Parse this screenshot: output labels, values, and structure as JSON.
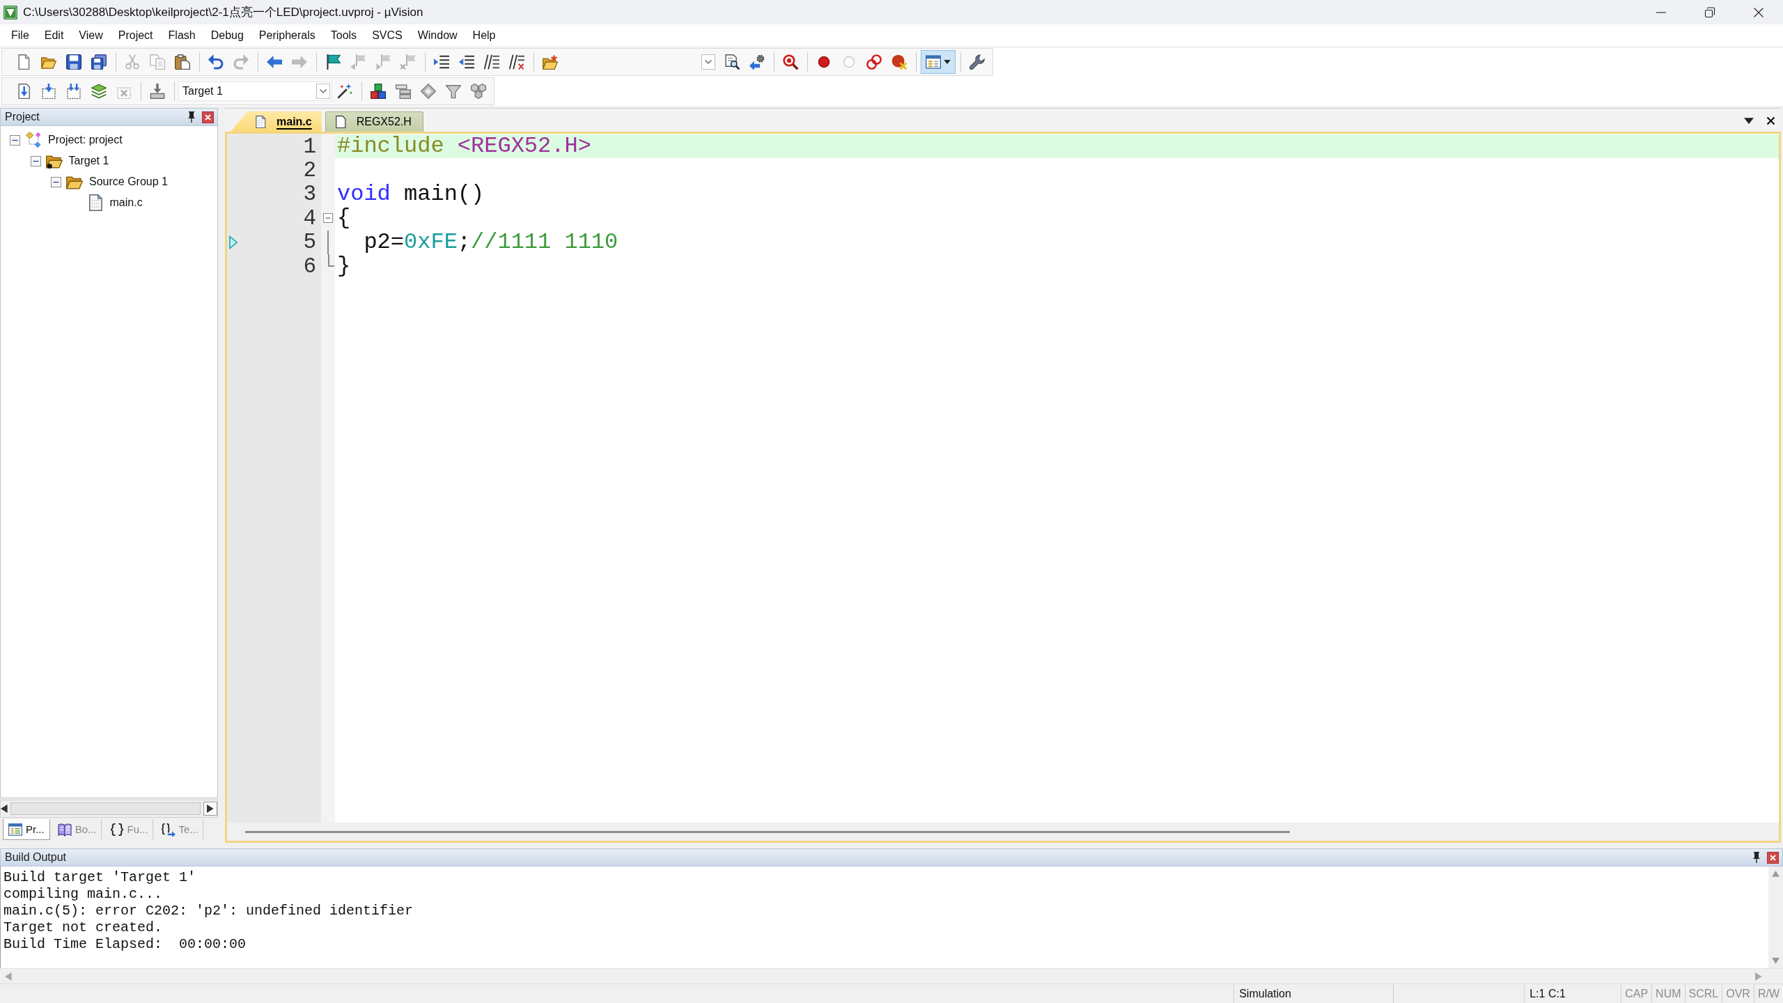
{
  "window": {
    "title": "C:\\Users\\30288\\Desktop\\keilproject\\2-1点亮一个LED\\project.uvproj - µVision"
  },
  "menu": [
    "File",
    "Edit",
    "View",
    "Project",
    "Flash",
    "Debug",
    "Peripherals",
    "Tools",
    "SVCS",
    "Window",
    "Help"
  ],
  "toolbars": [
    {
      "groups": [
        [
          {
            "kind": "new-file",
            "disabled": false,
            "pressed": false
          },
          {
            "kind": "open",
            "disabled": false,
            "pressed": false
          },
          {
            "kind": "save",
            "disabled": false,
            "pressed": false
          },
          {
            "kind": "save-all",
            "disabled": false,
            "pressed": false
          }
        ],
        [
          {
            "kind": "cut",
            "disabled": true,
            "pressed": false
          },
          {
            "kind": "copy",
            "disabled": true,
            "pressed": false
          },
          {
            "kind": "paste",
            "disabled": false,
            "pressed": false
          }
        ],
        [
          {
            "kind": "undo",
            "disabled": false,
            "pressed": false
          },
          {
            "kind": "redo",
            "disabled": true,
            "pressed": false
          }
        ],
        [
          {
            "kind": "back",
            "disabled": false,
            "pressed": false
          },
          {
            "kind": "forward",
            "disabled": true,
            "pressed": false
          }
        ],
        [
          {
            "kind": "bookmark",
            "disabled": false,
            "pressed": false
          },
          {
            "kind": "bookmark-prev",
            "disabled": true,
            "pressed": false
          },
          {
            "kind": "bookmark-next",
            "disabled": true,
            "pressed": false
          },
          {
            "kind": "bookmark-clear",
            "disabled": true,
            "pressed": false
          }
        ],
        [
          {
            "kind": "indent",
            "disabled": false,
            "pressed": false
          },
          {
            "kind": "outdent",
            "disabled": false,
            "pressed": false
          },
          {
            "kind": "comment",
            "disabled": false,
            "pressed": false
          },
          {
            "kind": "uncomment",
            "disabled": false,
            "pressed": false
          }
        ],
        [
          {
            "kind": "find-in-files",
            "disabled": false,
            "pressed": false
          },
          {
            "kind": "dropdown",
            "disabled": false,
            "pressed": false
          },
          {
            "kind": "find",
            "disabled": false,
            "pressed": false
          },
          {
            "kind": "find-arrow",
            "disabled": false,
            "pressed": false
          }
        ],
        [
          {
            "kind": "debug",
            "disabled": false,
            "pressed": false
          }
        ],
        [
          {
            "kind": "breakpoint",
            "disabled": false,
            "pressed": false
          },
          {
            "kind": "breakpoint-toggle",
            "disabled": true,
            "pressed": false
          },
          {
            "kind": "breakpoint-disable",
            "disabled": false,
            "pressed": false
          },
          {
            "kind": "breakpoint-kill",
            "disabled": false,
            "pressed": false
          }
        ],
        [
          {
            "kind": "layout",
            "disabled": false,
            "pressed": true
          }
        ],
        [
          {
            "kind": "wrench",
            "disabled": false,
            "pressed": false
          }
        ]
      ]
    },
    {
      "groups": [
        [
          {
            "kind": "translate",
            "disabled": false,
            "pressed": false
          },
          {
            "kind": "build",
            "disabled": false,
            "pressed": false
          },
          {
            "kind": "rebuild",
            "disabled": false,
            "pressed": false
          },
          {
            "kind": "layers",
            "disabled": false,
            "pressed": false
          },
          {
            "kind": "stop-build",
            "disabled": true,
            "pressed": false
          }
        ],
        [
          {
            "kind": "download",
            "disabled": false,
            "pressed": false
          }
        ],
        [
          {
            "kind": "combo",
            "value": "Target 1",
            "disabled": false,
            "pressed": false
          },
          {
            "kind": "wand",
            "disabled": false,
            "pressed": false
          }
        ],
        [
          {
            "kind": "blocks",
            "disabled": false,
            "pressed": false
          },
          {
            "kind": "stacked-bars",
            "disabled": false,
            "pressed": false
          },
          {
            "kind": "diamond",
            "disabled": false,
            "pressed": false
          },
          {
            "kind": "funnel",
            "disabled": false,
            "pressed": false
          },
          {
            "kind": "cubes",
            "disabled": false,
            "pressed": false
          }
        ]
      ]
    }
  ],
  "project_panel": {
    "title": "Project",
    "tree": [
      {
        "label": "Project: project",
        "kind": "project",
        "expanded": true,
        "children": [
          {
            "label": "Target 1",
            "kind": "target",
            "expanded": true,
            "children": [
              {
                "label": "Source Group 1",
                "kind": "group",
                "expanded": true,
                "children": [
                  {
                    "label": "main.c",
                    "kind": "file"
                  }
                ]
              }
            ]
          }
        ]
      }
    ],
    "tabs": [
      {
        "label": "Pr...",
        "kind": "project",
        "selected": true
      },
      {
        "label": "Bo...",
        "kind": "books",
        "selected": false
      },
      {
        "label": "Fu...",
        "kind": "functions",
        "selected": false
      },
      {
        "label": "Te...",
        "kind": "templates",
        "selected": false
      }
    ]
  },
  "editor": {
    "tabs": [
      {
        "label": "main.c",
        "selected": true
      },
      {
        "label": "REGX52.H",
        "selected": false
      }
    ],
    "lines": [
      {
        "number": "1",
        "highlighted": true,
        "marker": false,
        "fold_start": false,
        "fold_end": false,
        "tokens": [
          {
            "kind": "preprocessor",
            "text": "#include"
          },
          {
            "kind": "header",
            "text": " <REGX52.H>"
          }
        ]
      },
      {
        "number": "2",
        "highlighted": false,
        "marker": false,
        "fold_start": false,
        "fold_end": false
      },
      {
        "number": "3",
        "highlighted": false,
        "marker": false,
        "fold_start": false,
        "fold_end": false,
        "tokens": [
          {
            "kind": "keyword",
            "text": "void"
          },
          {
            "kind": "plain",
            "text": " main()"
          }
        ]
      },
      {
        "number": "4",
        "highlighted": false,
        "marker": false,
        "fold_start": true,
        "fold_end": false,
        "tokens": [
          {
            "kind": "plain",
            "text": "{"
          }
        ]
      },
      {
        "number": "5",
        "highlighted": false,
        "marker": true,
        "fold_start": false,
        "fold_end": false,
        "tokens": [
          {
            "kind": "plain",
            "text": "  p2="
          },
          {
            "kind": "number",
            "text": "0xFE"
          },
          {
            "kind": "plain",
            "text": ";"
          },
          {
            "kind": "comment",
            "text": "//1111 1110"
          }
        ]
      },
      {
        "number": "6",
        "highlighted": false,
        "marker": false,
        "fold_start": false,
        "fold_end": true,
        "tokens": [
          {
            "kind": "plain",
            "text": "}"
          }
        ]
      }
    ]
  },
  "build_output": {
    "title": "Build Output",
    "lines": [
      "Build target 'Target 1'",
      "compiling main.c...",
      "main.c(5): error C202: 'p2': undefined identifier",
      "Target not created.",
      "Build Time Elapsed:  00:00:00"
    ]
  },
  "status_bar": {
    "mode": "Simulation",
    "position": "L:1 C:1",
    "indicators": [
      {
        "label": "CAP",
        "on": false
      },
      {
        "label": "NUM",
        "on": false
      },
      {
        "label": "SCRL",
        "on": false
      },
      {
        "label": "OVR",
        "on": false
      },
      {
        "label": "R/W",
        "on": false
      }
    ]
  }
}
